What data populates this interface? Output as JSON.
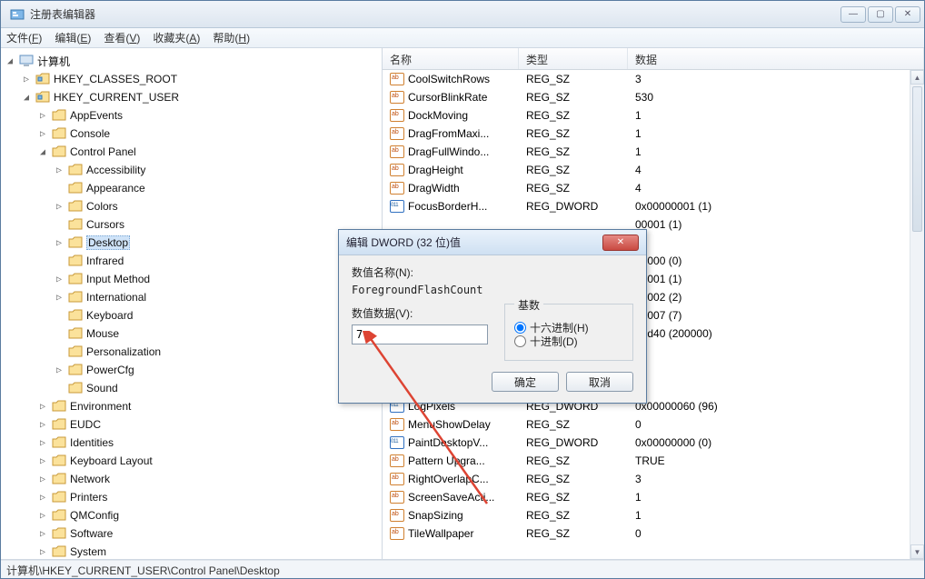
{
  "window": {
    "title": "注册表编辑器"
  },
  "win_controls": {
    "min": "—",
    "max": "▢",
    "close": "✕"
  },
  "menu": [
    {
      "label": "文件",
      "key": "F"
    },
    {
      "label": "编辑",
      "key": "E"
    },
    {
      "label": "查看",
      "key": "V"
    },
    {
      "label": "收藏夹",
      "key": "A"
    },
    {
      "label": "帮助",
      "key": "H"
    }
  ],
  "tree": [
    {
      "level": 0,
      "exp": "◢",
      "icon": "computer",
      "label": "计算机"
    },
    {
      "level": 1,
      "exp": "▷",
      "icon": "hive",
      "label": "HKEY_CLASSES_ROOT"
    },
    {
      "level": 1,
      "exp": "◢",
      "icon": "hive",
      "label": "HKEY_CURRENT_USER"
    },
    {
      "level": 2,
      "exp": "▷",
      "icon": "folder",
      "label": "AppEvents"
    },
    {
      "level": 2,
      "exp": "▷",
      "icon": "folder",
      "label": "Console"
    },
    {
      "level": 2,
      "exp": "◢",
      "icon": "folder",
      "label": "Control Panel"
    },
    {
      "level": 3,
      "exp": "▷",
      "icon": "folder",
      "label": "Accessibility"
    },
    {
      "level": 3,
      "exp": " ",
      "icon": "folder",
      "label": "Appearance"
    },
    {
      "level": 3,
      "exp": "▷",
      "icon": "folder",
      "label": "Colors"
    },
    {
      "level": 3,
      "exp": " ",
      "icon": "folder",
      "label": "Cursors"
    },
    {
      "level": 3,
      "exp": "▷",
      "icon": "folder",
      "label": "Desktop",
      "selected": true
    },
    {
      "level": 3,
      "exp": " ",
      "icon": "folder",
      "label": "Infrared"
    },
    {
      "level": 3,
      "exp": "▷",
      "icon": "folder",
      "label": "Input Method"
    },
    {
      "level": 3,
      "exp": "▷",
      "icon": "folder",
      "label": "International"
    },
    {
      "level": 3,
      "exp": " ",
      "icon": "folder",
      "label": "Keyboard"
    },
    {
      "level": 3,
      "exp": " ",
      "icon": "folder",
      "label": "Mouse"
    },
    {
      "level": 3,
      "exp": " ",
      "icon": "folder",
      "label": "Personalization"
    },
    {
      "level": 3,
      "exp": "▷",
      "icon": "folder",
      "label": "PowerCfg"
    },
    {
      "level": 3,
      "exp": " ",
      "icon": "folder",
      "label": "Sound"
    },
    {
      "level": 2,
      "exp": "▷",
      "icon": "folder",
      "label": "Environment"
    },
    {
      "level": 2,
      "exp": "▷",
      "icon": "folder",
      "label": "EUDC"
    },
    {
      "level": 2,
      "exp": "▷",
      "icon": "folder",
      "label": "Identities"
    },
    {
      "level": 2,
      "exp": "▷",
      "icon": "folder",
      "label": "Keyboard Layout"
    },
    {
      "level": 2,
      "exp": "▷",
      "icon": "folder",
      "label": "Network"
    },
    {
      "level": 2,
      "exp": "▷",
      "icon": "folder",
      "label": "Printers"
    },
    {
      "level": 2,
      "exp": "▷",
      "icon": "folder",
      "label": "QMConfig"
    },
    {
      "level": 2,
      "exp": "▷",
      "icon": "folder",
      "label": "Software"
    },
    {
      "level": 2,
      "exp": "▷",
      "icon": "folder",
      "label": "System"
    }
  ],
  "columns": {
    "name": "名称",
    "type": "类型",
    "data": "数据"
  },
  "values": [
    {
      "name": "CoolSwitchRows",
      "type": "REG_SZ",
      "data": "3",
      "ico": "sz"
    },
    {
      "name": "CursorBlinkRate",
      "type": "REG_SZ",
      "data": "530",
      "ico": "sz"
    },
    {
      "name": "DockMoving",
      "type": "REG_SZ",
      "data": "1",
      "ico": "sz"
    },
    {
      "name": "DragFromMaxi...",
      "type": "REG_SZ",
      "data": "1",
      "ico": "sz"
    },
    {
      "name": "DragFullWindo...",
      "type": "REG_SZ",
      "data": "1",
      "ico": "sz"
    },
    {
      "name": "DragHeight",
      "type": "REG_SZ",
      "data": "4",
      "ico": "sz"
    },
    {
      "name": "DragWidth",
      "type": "REG_SZ",
      "data": "4",
      "ico": "sz"
    },
    {
      "name": "FocusBorderH...",
      "type": "REG_DWORD",
      "data": "0x00000001 (1)",
      "ico": "dw"
    },
    {
      "name": "",
      "type": "",
      "data": "00001 (1)",
      "ico": ""
    },
    {
      "name": "",
      "type": "",
      "data": "",
      "ico": ""
    },
    {
      "name": "",
      "type": "",
      "data": "00000 (0)",
      "ico": ""
    },
    {
      "name": "",
      "type": "",
      "data": "00001 (1)",
      "ico": ""
    },
    {
      "name": "",
      "type": "",
      "data": "00002 (2)",
      "ico": ""
    },
    {
      "name": "",
      "type": "",
      "data": "00007 (7)",
      "ico": ""
    },
    {
      "name": "",
      "type": "",
      "data": "30d40 (200000)",
      "ico": ""
    },
    {
      "name": "",
      "type": "",
      "data": "",
      "ico": ""
    },
    {
      "name": "",
      "type": "",
      "data": "",
      "ico": ""
    },
    {
      "name": "",
      "type": "",
      "data": "",
      "ico": ""
    },
    {
      "name": "LogPixels",
      "type": "REG_DWORD",
      "data": "0x00000060 (96)",
      "ico": "dw"
    },
    {
      "name": "MenuShowDelay",
      "type": "REG_SZ",
      "data": "0",
      "ico": "sz"
    },
    {
      "name": "PaintDesktopV...",
      "type": "REG_DWORD",
      "data": "0x00000000 (0)",
      "ico": "dw"
    },
    {
      "name": "Pattern Upgra...",
      "type": "REG_SZ",
      "data": "TRUE",
      "ico": "sz"
    },
    {
      "name": "RightOverlapC...",
      "type": "REG_SZ",
      "data": "3",
      "ico": "sz"
    },
    {
      "name": "ScreenSaveActi...",
      "type": "REG_SZ",
      "data": "1",
      "ico": "sz"
    },
    {
      "name": "SnapSizing",
      "type": "REG_SZ",
      "data": "1",
      "ico": "sz"
    },
    {
      "name": "TileWallpaper",
      "type": "REG_SZ",
      "data": "0",
      "ico": "sz"
    }
  ],
  "dialog": {
    "title": "编辑 DWORD (32 位)值",
    "name_label": "数值名称(N):",
    "value_name": "ForegroundFlashCount",
    "data_label": "数值数据(V):",
    "data_value": "7",
    "base_label": "基数",
    "radio_hex": "十六进制(H)",
    "radio_dec": "十进制(D)",
    "ok": "确定",
    "cancel": "取消",
    "close": "✕"
  },
  "statusbar": "计算机\\HKEY_CURRENT_USER\\Control Panel\\Desktop"
}
